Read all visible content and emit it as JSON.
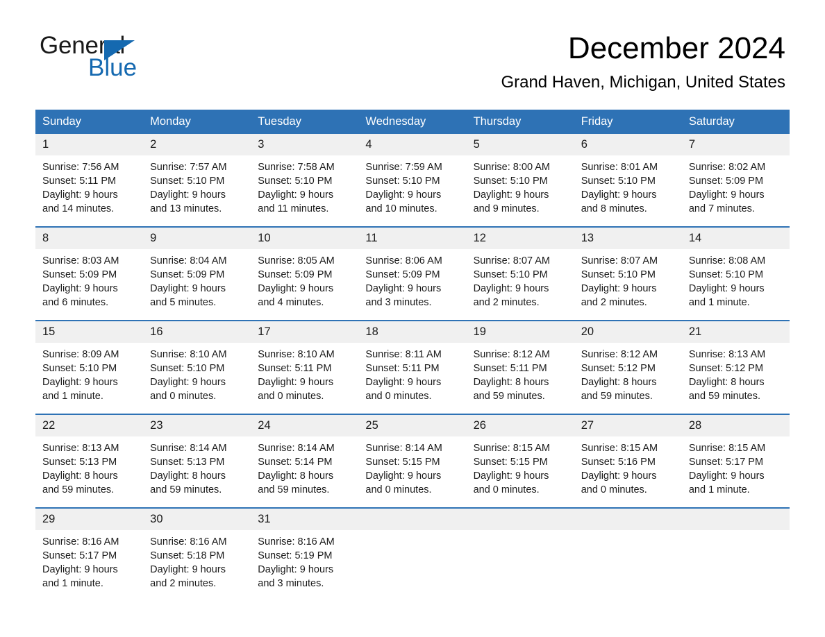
{
  "brand": {
    "name_part1": "General",
    "name_part2": "Blue",
    "accent_color": "#1569b0"
  },
  "header": {
    "title": "December 2024",
    "location": "Grand Haven, Michigan, United States"
  },
  "calendar": {
    "header_color": "#2e72b5",
    "daynum_band_color": "#f0f0f0",
    "weekday_headers": [
      "Sunday",
      "Monday",
      "Tuesday",
      "Wednesday",
      "Thursday",
      "Friday",
      "Saturday"
    ],
    "weeks": [
      [
        {
          "day": "1",
          "sunrise": "Sunrise: 7:56 AM",
          "sunset": "Sunset: 5:11 PM",
          "daylight": "Daylight: 9 hours and 14 minutes."
        },
        {
          "day": "2",
          "sunrise": "Sunrise: 7:57 AM",
          "sunset": "Sunset: 5:10 PM",
          "daylight": "Daylight: 9 hours and 13 minutes."
        },
        {
          "day": "3",
          "sunrise": "Sunrise: 7:58 AM",
          "sunset": "Sunset: 5:10 PM",
          "daylight": "Daylight: 9 hours and 11 minutes."
        },
        {
          "day": "4",
          "sunrise": "Sunrise: 7:59 AM",
          "sunset": "Sunset: 5:10 PM",
          "daylight": "Daylight: 9 hours and 10 minutes."
        },
        {
          "day": "5",
          "sunrise": "Sunrise: 8:00 AM",
          "sunset": "Sunset: 5:10 PM",
          "daylight": "Daylight: 9 hours and 9 minutes."
        },
        {
          "day": "6",
          "sunrise": "Sunrise: 8:01 AM",
          "sunset": "Sunset: 5:10 PM",
          "daylight": "Daylight: 9 hours and 8 minutes."
        },
        {
          "day": "7",
          "sunrise": "Sunrise: 8:02 AM",
          "sunset": "Sunset: 5:09 PM",
          "daylight": "Daylight: 9 hours and 7 minutes."
        }
      ],
      [
        {
          "day": "8",
          "sunrise": "Sunrise: 8:03 AM",
          "sunset": "Sunset: 5:09 PM",
          "daylight": "Daylight: 9 hours and 6 minutes."
        },
        {
          "day": "9",
          "sunrise": "Sunrise: 8:04 AM",
          "sunset": "Sunset: 5:09 PM",
          "daylight": "Daylight: 9 hours and 5 minutes."
        },
        {
          "day": "10",
          "sunrise": "Sunrise: 8:05 AM",
          "sunset": "Sunset: 5:09 PM",
          "daylight": "Daylight: 9 hours and 4 minutes."
        },
        {
          "day": "11",
          "sunrise": "Sunrise: 8:06 AM",
          "sunset": "Sunset: 5:09 PM",
          "daylight": "Daylight: 9 hours and 3 minutes."
        },
        {
          "day": "12",
          "sunrise": "Sunrise: 8:07 AM",
          "sunset": "Sunset: 5:10 PM",
          "daylight": "Daylight: 9 hours and 2 minutes."
        },
        {
          "day": "13",
          "sunrise": "Sunrise: 8:07 AM",
          "sunset": "Sunset: 5:10 PM",
          "daylight": "Daylight: 9 hours and 2 minutes."
        },
        {
          "day": "14",
          "sunrise": "Sunrise: 8:08 AM",
          "sunset": "Sunset: 5:10 PM",
          "daylight": "Daylight: 9 hours and 1 minute."
        }
      ],
      [
        {
          "day": "15",
          "sunrise": "Sunrise: 8:09 AM",
          "sunset": "Sunset: 5:10 PM",
          "daylight": "Daylight: 9 hours and 1 minute."
        },
        {
          "day": "16",
          "sunrise": "Sunrise: 8:10 AM",
          "sunset": "Sunset: 5:10 PM",
          "daylight": "Daylight: 9 hours and 0 minutes."
        },
        {
          "day": "17",
          "sunrise": "Sunrise: 8:10 AM",
          "sunset": "Sunset: 5:11 PM",
          "daylight": "Daylight: 9 hours and 0 minutes."
        },
        {
          "day": "18",
          "sunrise": "Sunrise: 8:11 AM",
          "sunset": "Sunset: 5:11 PM",
          "daylight": "Daylight: 9 hours and 0 minutes."
        },
        {
          "day": "19",
          "sunrise": "Sunrise: 8:12 AM",
          "sunset": "Sunset: 5:11 PM",
          "daylight": "Daylight: 8 hours and 59 minutes."
        },
        {
          "day": "20",
          "sunrise": "Sunrise: 8:12 AM",
          "sunset": "Sunset: 5:12 PM",
          "daylight": "Daylight: 8 hours and 59 minutes."
        },
        {
          "day": "21",
          "sunrise": "Sunrise: 8:13 AM",
          "sunset": "Sunset: 5:12 PM",
          "daylight": "Daylight: 8 hours and 59 minutes."
        }
      ],
      [
        {
          "day": "22",
          "sunrise": "Sunrise: 8:13 AM",
          "sunset": "Sunset: 5:13 PM",
          "daylight": "Daylight: 8 hours and 59 minutes."
        },
        {
          "day": "23",
          "sunrise": "Sunrise: 8:14 AM",
          "sunset": "Sunset: 5:13 PM",
          "daylight": "Daylight: 8 hours and 59 minutes."
        },
        {
          "day": "24",
          "sunrise": "Sunrise: 8:14 AM",
          "sunset": "Sunset: 5:14 PM",
          "daylight": "Daylight: 8 hours and 59 minutes."
        },
        {
          "day": "25",
          "sunrise": "Sunrise: 8:14 AM",
          "sunset": "Sunset: 5:15 PM",
          "daylight": "Daylight: 9 hours and 0 minutes."
        },
        {
          "day": "26",
          "sunrise": "Sunrise: 8:15 AM",
          "sunset": "Sunset: 5:15 PM",
          "daylight": "Daylight: 9 hours and 0 minutes."
        },
        {
          "day": "27",
          "sunrise": "Sunrise: 8:15 AM",
          "sunset": "Sunset: 5:16 PM",
          "daylight": "Daylight: 9 hours and 0 minutes."
        },
        {
          "day": "28",
          "sunrise": "Sunrise: 8:15 AM",
          "sunset": "Sunset: 5:17 PM",
          "daylight": "Daylight: 9 hours and 1 minute."
        }
      ],
      [
        {
          "day": "29",
          "sunrise": "Sunrise: 8:16 AM",
          "sunset": "Sunset: 5:17 PM",
          "daylight": "Daylight: 9 hours and 1 minute."
        },
        {
          "day": "30",
          "sunrise": "Sunrise: 8:16 AM",
          "sunset": "Sunset: 5:18 PM",
          "daylight": "Daylight: 9 hours and 2 minutes."
        },
        {
          "day": "31",
          "sunrise": "Sunrise: 8:16 AM",
          "sunset": "Sunset: 5:19 PM",
          "daylight": "Daylight: 9 hours and 3 minutes."
        },
        {
          "day": "",
          "sunrise": "",
          "sunset": "",
          "daylight": ""
        },
        {
          "day": "",
          "sunrise": "",
          "sunset": "",
          "daylight": ""
        },
        {
          "day": "",
          "sunrise": "",
          "sunset": "",
          "daylight": ""
        },
        {
          "day": "",
          "sunrise": "",
          "sunset": "",
          "daylight": ""
        }
      ]
    ]
  }
}
